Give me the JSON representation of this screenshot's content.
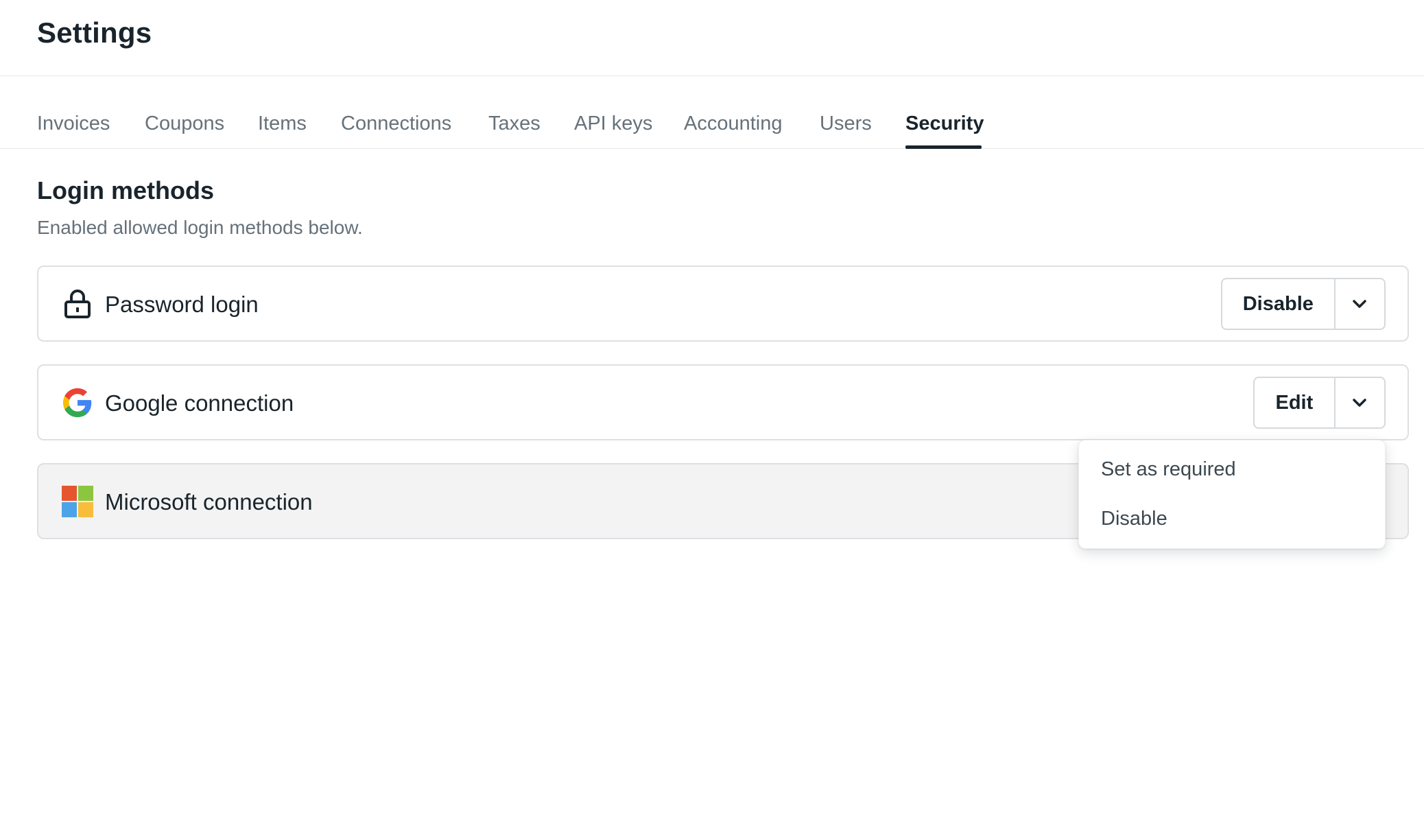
{
  "header": {
    "title": "Settings"
  },
  "tabs": [
    {
      "label": "Invoices",
      "active": false
    },
    {
      "label": "Coupons",
      "active": false
    },
    {
      "label": "Items",
      "active": false
    },
    {
      "label": "Connections",
      "active": false
    },
    {
      "label": "Taxes",
      "active": false
    },
    {
      "label": "API keys",
      "active": false
    },
    {
      "label": "Accounting",
      "active": false
    },
    {
      "label": "Users",
      "active": false
    },
    {
      "label": "Security",
      "active": true
    }
  ],
  "section": {
    "title": "Login methods",
    "description": "Enabled allowed login methods below."
  },
  "methods": [
    {
      "label": "Password login",
      "icon": "lock-icon",
      "action_label": "Disable"
    },
    {
      "label": "Google connection",
      "icon": "google-logo-icon",
      "action_label": "Edit"
    },
    {
      "label": "Microsoft connection",
      "icon": "microsoft-logo-icon",
      "action_label": ""
    }
  ],
  "dropdown": {
    "items": [
      {
        "label": "Set as required"
      },
      {
        "label": "Disable"
      }
    ]
  },
  "colors": {
    "text_primary": "#19242c",
    "text_secondary": "#66717a",
    "border": "#dde0e3",
    "microsoft_red": "#e5562f",
    "microsoft_green": "#8cc63f",
    "microsoft_blue": "#4da3e8",
    "microsoft_yellow": "#f9bd3c",
    "google_blue": "#4285f4",
    "google_red": "#ea4335",
    "google_yellow": "#fbbc05",
    "google_green": "#34a853"
  }
}
